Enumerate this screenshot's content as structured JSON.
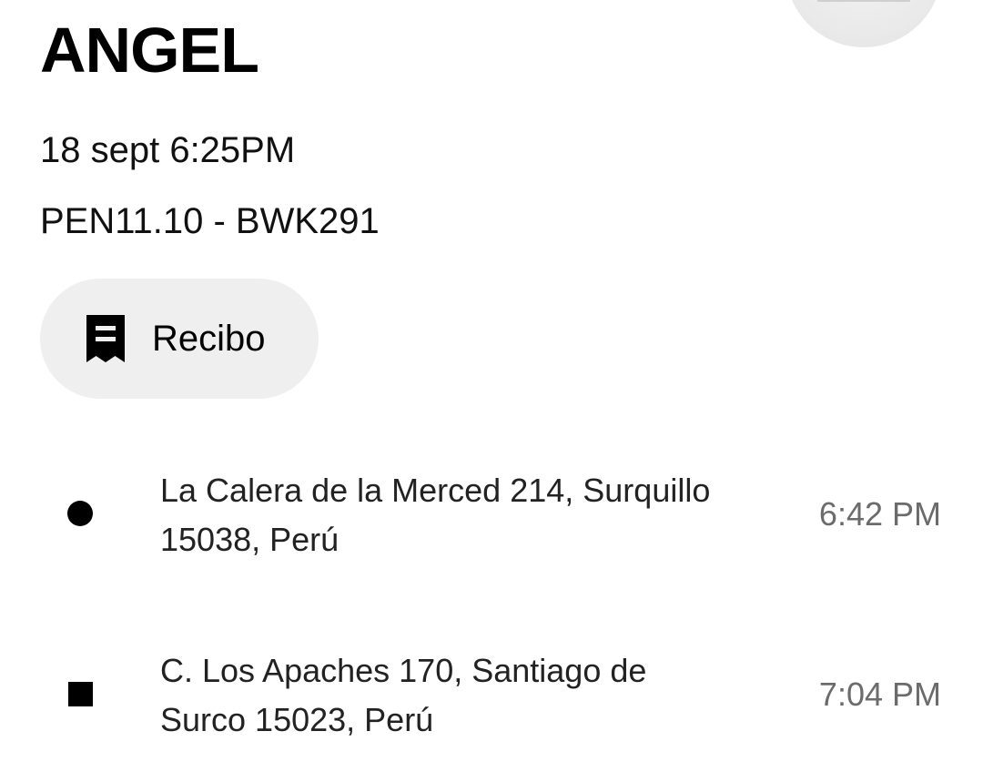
{
  "header": {
    "driver_name": "ANGEL",
    "date_time": "18 sept 6:25PM",
    "fare_plate": "PEN11.10 - BWK291"
  },
  "actions": {
    "receipt_label": "Recibo",
    "receipt_icon": "receipt-icon"
  },
  "route": {
    "stops": [
      {
        "marker": "circle-dot-icon",
        "address_line1": "La Calera de la Merced 214, Surquillo",
        "address_line2": "15038, Perú",
        "time": "6:42 PM"
      },
      {
        "marker": "square-stop-icon",
        "address_line1": "C. Los Apaches 170, Santiago de",
        "address_line2": "Surco 15023, Perú",
        "time": "7:04 PM"
      }
    ]
  },
  "colors": {
    "text_primary": "#000000",
    "text_secondary": "#6b6b6b",
    "button_bg": "#efefef"
  }
}
